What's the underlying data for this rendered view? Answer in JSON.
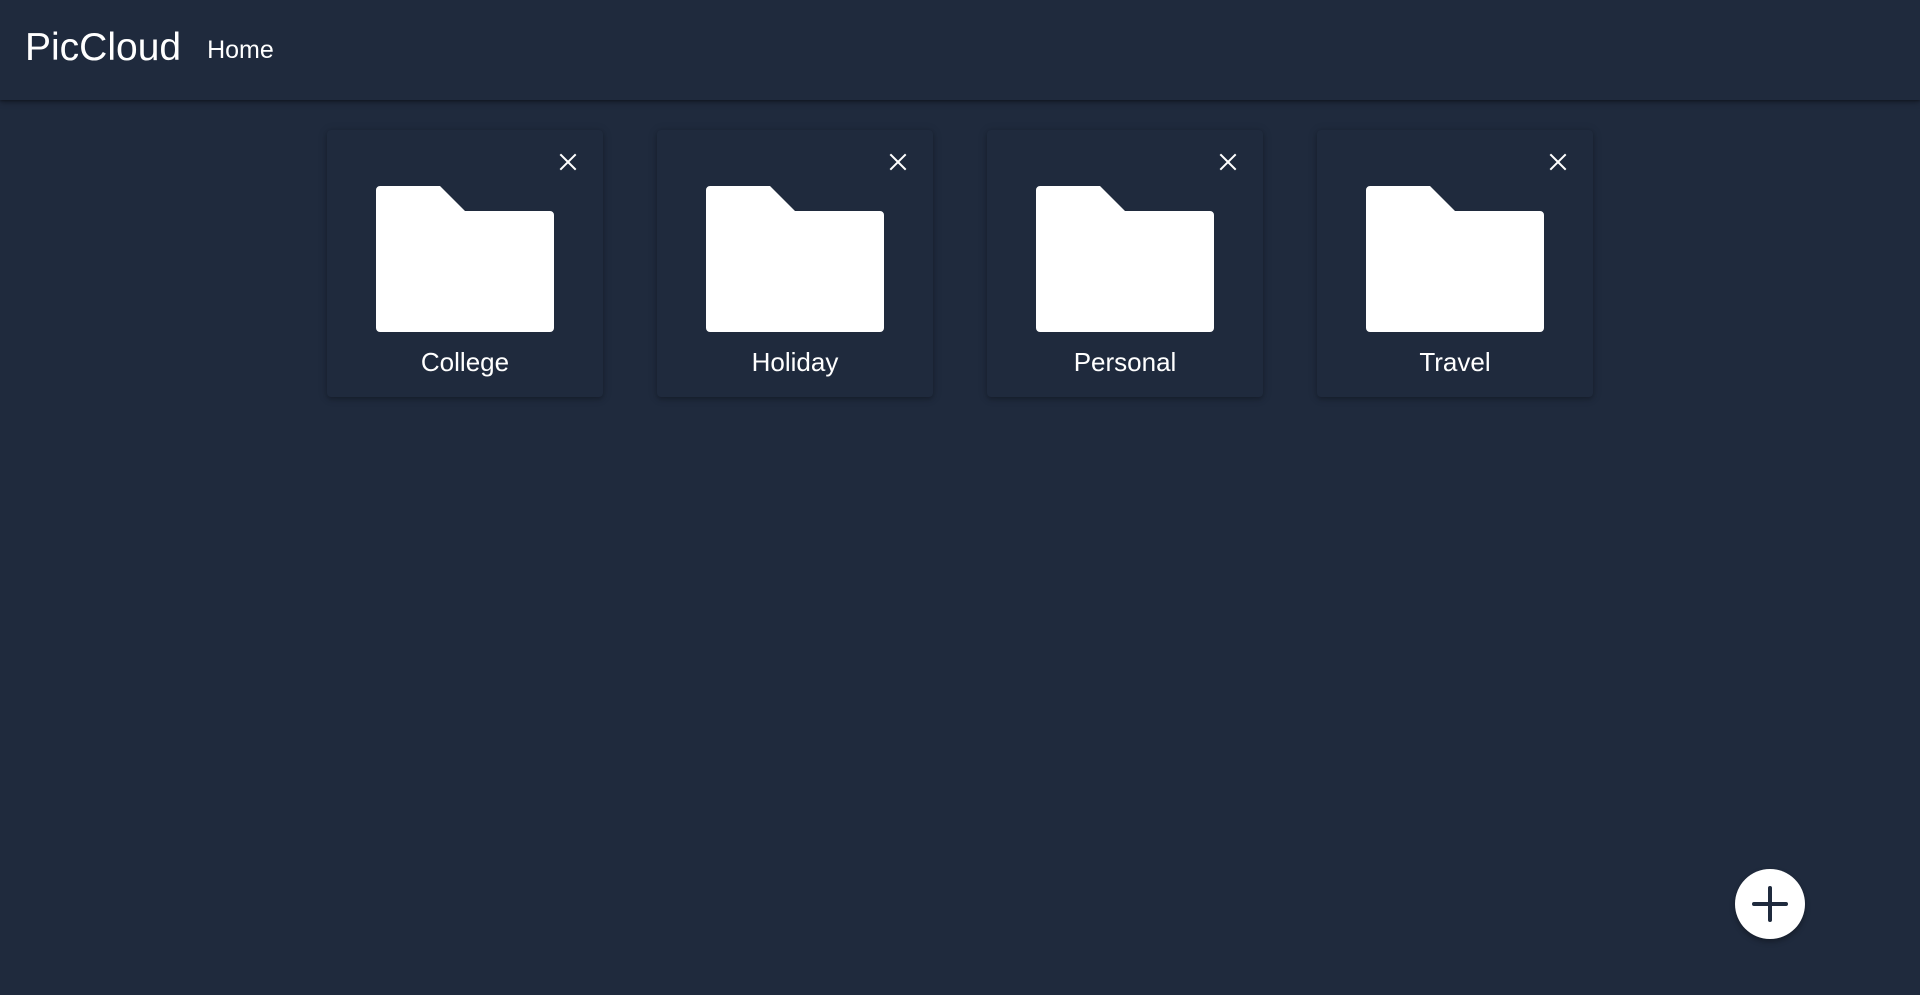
{
  "header": {
    "brand": "PicCloud",
    "nav_home": "Home"
  },
  "folders": [
    {
      "label": "College",
      "icon": "folder-icon",
      "close_icon": "close-icon"
    },
    {
      "label": "Holiday",
      "icon": "folder-icon",
      "close_icon": "close-icon"
    },
    {
      "label": "Personal",
      "icon": "folder-icon",
      "close_icon": "close-icon"
    },
    {
      "label": "Travel",
      "icon": "folder-icon",
      "close_icon": "close-icon"
    }
  ],
  "fab": {
    "icon": "plus-icon"
  },
  "colors": {
    "background": "#1f2a3d",
    "foreground": "#ffffff"
  }
}
